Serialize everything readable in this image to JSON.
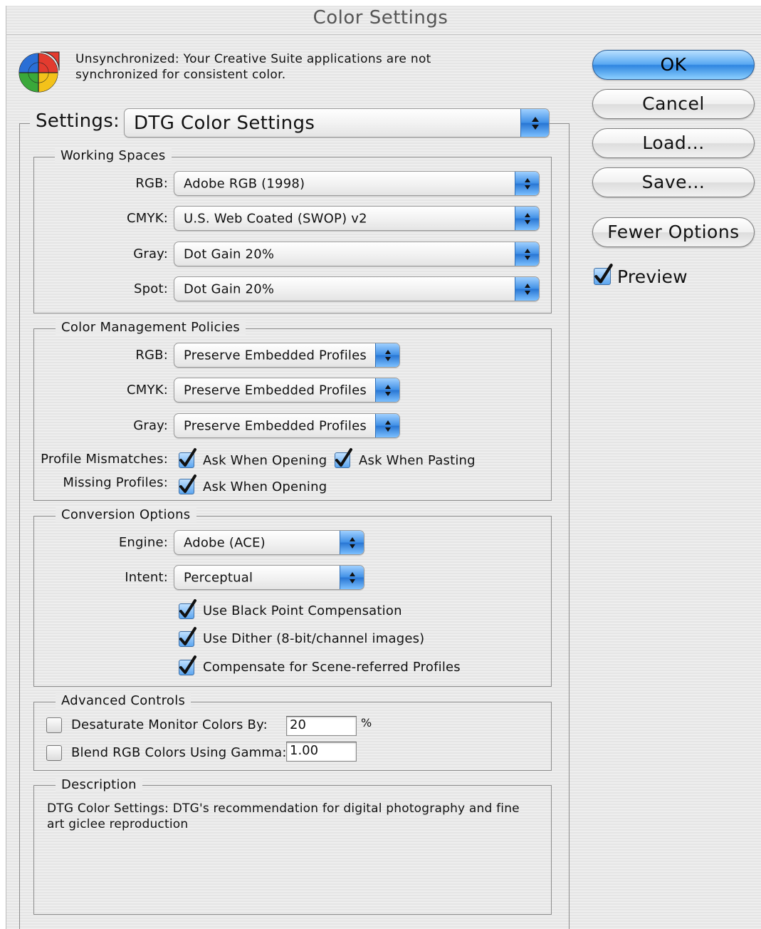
{
  "window": {
    "title": "Color Settings"
  },
  "sync": {
    "message": "Unsynchronized: Your Creative Suite applications are not synchronized for consistent color."
  },
  "settings": {
    "label": "Settings:",
    "value": "DTG Color Settings"
  },
  "working_spaces": {
    "title": "Working Spaces",
    "rows": [
      {
        "label": "RGB:",
        "value": "Adobe RGB (1998)"
      },
      {
        "label": "CMYK:",
        "value": "U.S. Web Coated (SWOP) v2"
      },
      {
        "label": "Gray:",
        "value": "Dot Gain 20%"
      },
      {
        "label": "Spot:",
        "value": "Dot Gain 20%"
      }
    ]
  },
  "policies": {
    "title": "Color Management Policies",
    "rows": [
      {
        "label": "RGB:",
        "value": "Preserve Embedded Profiles"
      },
      {
        "label": "CMYK:",
        "value": "Preserve Embedded Profiles"
      },
      {
        "label": "Gray:",
        "value": "Preserve Embedded Profiles"
      }
    ],
    "profile_mismatches": {
      "label": "Profile Mismatches:",
      "ask_opening": {
        "label": "Ask When Opening",
        "checked": true
      },
      "ask_pasting": {
        "label": "Ask When Pasting",
        "checked": true
      }
    },
    "missing_profiles": {
      "label": "Missing Profiles:",
      "ask_opening": {
        "label": "Ask When Opening",
        "checked": true
      }
    }
  },
  "conversion": {
    "title": "Conversion Options",
    "engine": {
      "label": "Engine:",
      "value": "Adobe (ACE)"
    },
    "intent": {
      "label": "Intent:",
      "value": "Perceptual"
    },
    "options": [
      {
        "label": "Use Black Point Compensation",
        "checked": true
      },
      {
        "label": "Use Dither (8-bit/channel images)",
        "checked": true
      },
      {
        "label": "Compensate for Scene-referred Profiles",
        "checked": true
      }
    ]
  },
  "advanced": {
    "title": "Advanced Controls",
    "desaturate": {
      "label": "Desaturate Monitor Colors By:",
      "value": "20",
      "unit": "%",
      "checked": false
    },
    "blend": {
      "label": "Blend RGB Colors Using Gamma:",
      "value": "1.00",
      "checked": false
    }
  },
  "description": {
    "title": "Description",
    "text": "DTG Color Settings:  DTG's recommendation for digital photography and fine art giclee reproduction"
  },
  "buttons": {
    "ok": "OK",
    "cancel": "Cancel",
    "load": "Load...",
    "save": "Save...",
    "fewer_options": "Fewer Options"
  },
  "preview": {
    "label": "Preview",
    "checked": true
  },
  "colors": {
    "accent": "#3f8fe6",
    "icon_red": "#e33b2f",
    "icon_green": "#3aa83a",
    "icon_blue": "#2a6fd6",
    "icon_yellow": "#f3c21a"
  },
  "icons": {
    "app_icon": "color-wheel-icon",
    "popup_arrows": "updown-arrows-icon",
    "checkmark": "checkmark-icon"
  }
}
